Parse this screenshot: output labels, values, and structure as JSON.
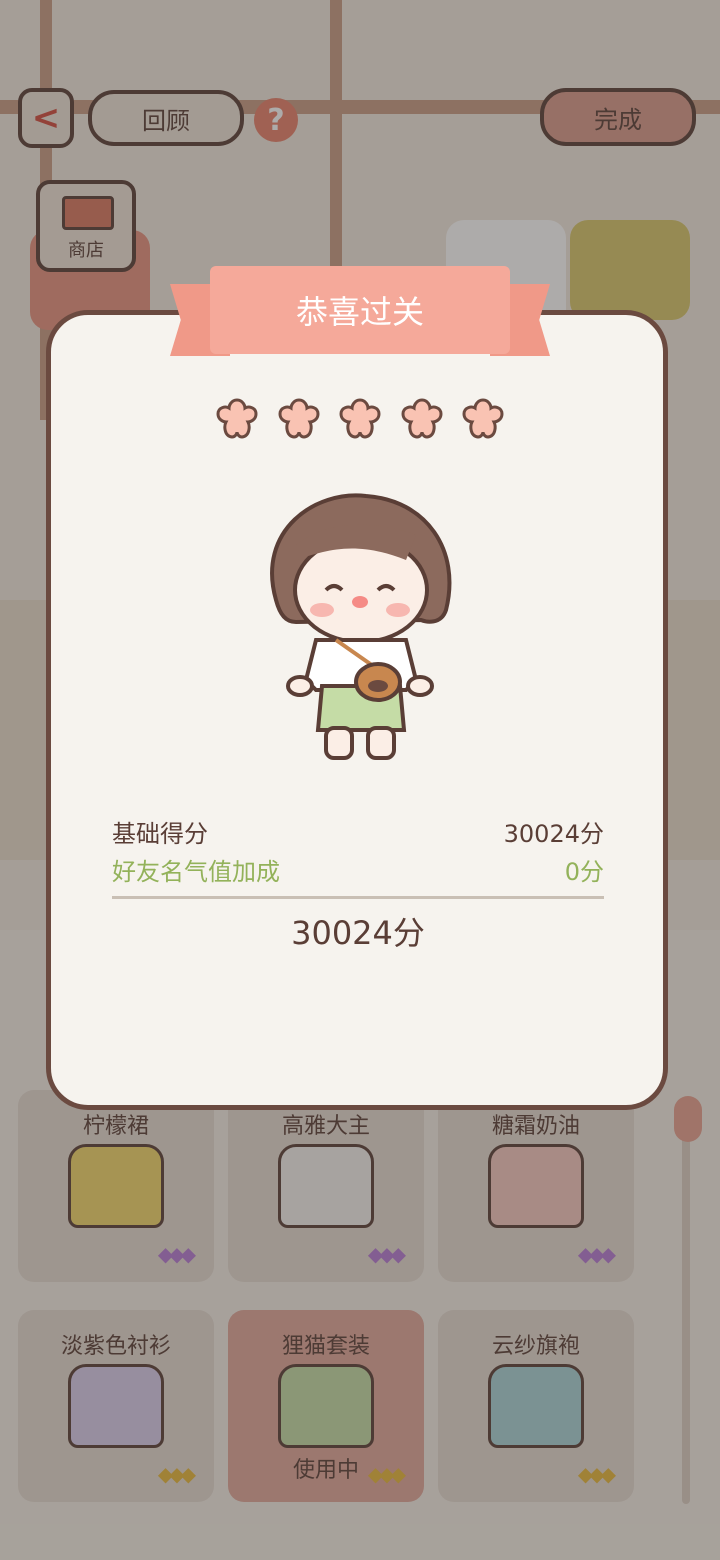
{
  "header": {
    "back_label": "<",
    "review_label": "回顾",
    "help_label": "?",
    "done_label": "完成"
  },
  "shop": {
    "label": "商店"
  },
  "modal": {
    "title": "恭喜过关",
    "stars": 5,
    "base_score_label": "基础得分",
    "base_score_value": "30024分",
    "bonus_label": "好友名气值加成",
    "bonus_value": "0分",
    "total": "30024分"
  },
  "wardrobe": {
    "items": [
      {
        "name": "柠檬裙",
        "color": "#f3d86a",
        "rarity": "purple"
      },
      {
        "name": "高雅大主",
        "color": "#f4f1ee",
        "rarity": "purple"
      },
      {
        "name": "糖霜奶油",
        "color": "#f7c8bf",
        "rarity": "purple"
      },
      {
        "name": "淡紫色衬衫",
        "color": "#d9cdec",
        "rarity": "gold"
      },
      {
        "name": "狸猫套装",
        "color": "#c5dca6",
        "rarity": "gold",
        "status": "使用中"
      },
      {
        "name": "云纱旗袍",
        "color": "#a9d4d8",
        "rarity": "gold"
      }
    ]
  },
  "colors": {
    "accent": "#f5a99a",
    "bonus_text": "#93b25a",
    "rarity_purple": "#b77ad6",
    "rarity_gold": "#e8b83a"
  }
}
